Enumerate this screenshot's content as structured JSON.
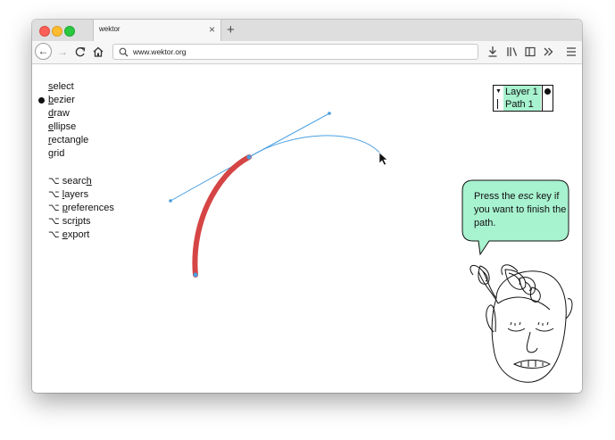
{
  "browser": {
    "tab_title": "wektor",
    "tab_close": "×",
    "new_tab": "+",
    "url": "www.wektor.org"
  },
  "tools": [
    {
      "pre": "",
      "key": "s",
      "post": "elect",
      "active": false
    },
    {
      "pre": "",
      "key": "b",
      "post": "ezier",
      "active": true
    },
    {
      "pre": "",
      "key": "d",
      "post": "raw",
      "active": false
    },
    {
      "pre": "",
      "key": "e",
      "post": "llipse",
      "active": false
    },
    {
      "pre": "",
      "key": "r",
      "post": "ectangle",
      "active": false
    },
    {
      "pre": "",
      "key": "g",
      "post": "rid",
      "active": false
    }
  ],
  "panels": [
    {
      "pre": "⌥ searc",
      "key": "h",
      "post": ""
    },
    {
      "pre": "⌥ ",
      "key": "l",
      "post": "ayers"
    },
    {
      "pre": "⌥ ",
      "key": "p",
      "post": "references"
    },
    {
      "pre": "⌥ scr",
      "key": "i",
      "post": "pts"
    },
    {
      "pre": "⌥ ",
      "key": "e",
      "post": "xport"
    }
  ],
  "layers": {
    "layer_name": "Layer 1",
    "path_name": "Path 1"
  },
  "hint": {
    "pre": "Press the ",
    "key": "esc",
    "post": " key if you want to finish the path."
  },
  "colors": {
    "stroke_red": "#d64545",
    "handle_blue": "#4a9fe0",
    "selection_green": "#a7f2cf"
  }
}
